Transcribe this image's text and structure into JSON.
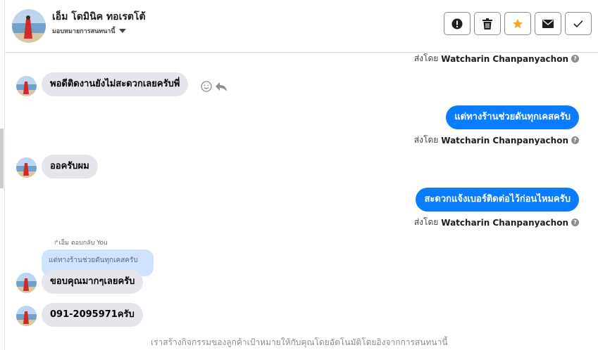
{
  "header": {
    "contact_name": "เอ็ม โดมินิค ทอเรตโต้",
    "assign_label": "มอบหมายการสนทนานี้"
  },
  "actions": [
    {
      "name": "report",
      "icon": "exclamation-icon"
    },
    {
      "name": "delete",
      "icon": "trash-icon"
    },
    {
      "name": "star",
      "icon": "star-icon",
      "color": "#f5a623"
    },
    {
      "name": "mark-unread",
      "icon": "envelope-icon"
    },
    {
      "name": "mark-done",
      "icon": "checkmark-icon"
    }
  ],
  "colors": {
    "outgoing_bubble": "#0a7cff",
    "incoming_bubble": "#e4e6eb",
    "quoted_bubble": "#cfe2ff",
    "star": "#f5a623"
  },
  "sent_by_prefix": "ส่งโดย",
  "agent_name": "Watcharin Chanpanyachon",
  "messages": [
    {
      "direction": "in",
      "text": "พอดีติดงานยังไม่สะดวกเลยครับพี่"
    },
    {
      "direction": "out",
      "text": "แต่ทางร้านช่วยดันทุกเคสครับ"
    },
    {
      "direction": "in",
      "text": "ออครับผม"
    },
    {
      "direction": "out",
      "text": "สะดวกแจ้งเบอร์ติดต่อไว้ก่อนไหมครับ"
    },
    {
      "direction": "in",
      "text": "ขอบคุณมากๆเลยครับ",
      "reply_label": "เอ็ม ตอบกลับ You",
      "quoted_text": "แต่ทางร้านช่วยดันทุกเคสครับ"
    },
    {
      "direction": "in",
      "text": "091-2095971ครับ"
    }
  ],
  "footer_note": "เราสร้างกิจกรรมของลูกค้าเป้าหมายให้กับคุณโดยอัตโนมัติโดยอิงจากการสนทนานี้"
}
